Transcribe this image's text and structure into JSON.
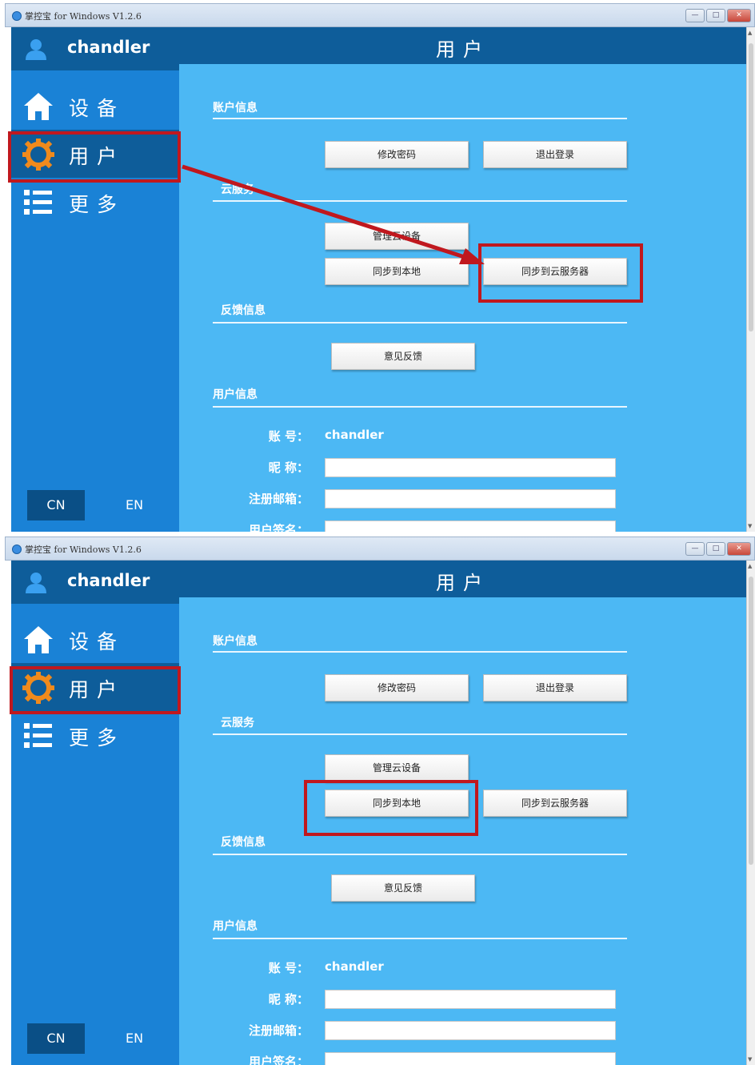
{
  "window": {
    "title": "掌控宝 for Windows V1.2.6",
    "ctrl_min": "—",
    "ctrl_max": "□",
    "ctrl_close": "✕"
  },
  "user": {
    "name": "chandler"
  },
  "nav": {
    "devices": "设备",
    "user": "用户",
    "more": "更多"
  },
  "lang": {
    "cn": "CN",
    "en": "EN"
  },
  "header": {
    "title": "用户"
  },
  "sections": {
    "account": "账户信息",
    "cloud": "云服务",
    "feedback": "反馈信息",
    "userinfo": "用户信息"
  },
  "buttons": {
    "change_password": "修改密码",
    "logout": "退出登录",
    "manage_cloud": "管理云设备",
    "sync_local": "同步到本地",
    "sync_cloud": "同步到云服务器",
    "feedback": "意见反馈"
  },
  "fields": {
    "account_label": "账 号：",
    "account_value": "chandler",
    "nickname_label": "昵 称：",
    "email_label": "注册邮箱：",
    "signature_label": "用户签名："
  },
  "colors": {
    "sidebar": "#1a82d6",
    "sidebar_dark": "#0e5d9a",
    "main_bg": "#4cb8f4",
    "highlight": "#c0181e",
    "icon_orange": "#f08a1c"
  }
}
